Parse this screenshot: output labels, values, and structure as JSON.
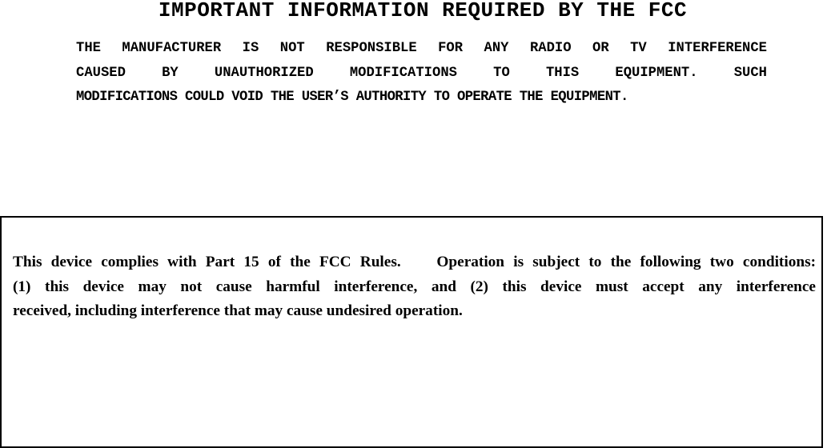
{
  "document": {
    "title": "IMPORTANT INFORMATION REQUIRED BY THE FCC",
    "manufacturer_notice": {
      "lines": [
        "THE MANUFACTURER IS NOT RESPONSIBLE FOR ANY RADIO OR TV INTERFERENCE",
        "CAUSED BY UNAUTHORIZED MODIFICATIONS TO THIS EQUIPMENT. SUCH",
        "MODIFICATIONS COULD VOID THE USER’S AUTHORITY TO OPERATE THE EQUIPMENT."
      ]
    },
    "compliance_statement": {
      "lines": [
        "This device complies with Part 15 of the FCC Rules.    Operation is subject to the following two conditions:",
        "(1) this device may not cause harmful interference, and (2) this device must accept any interference",
        "received, including interference that may cause undesired operation."
      ]
    }
  }
}
